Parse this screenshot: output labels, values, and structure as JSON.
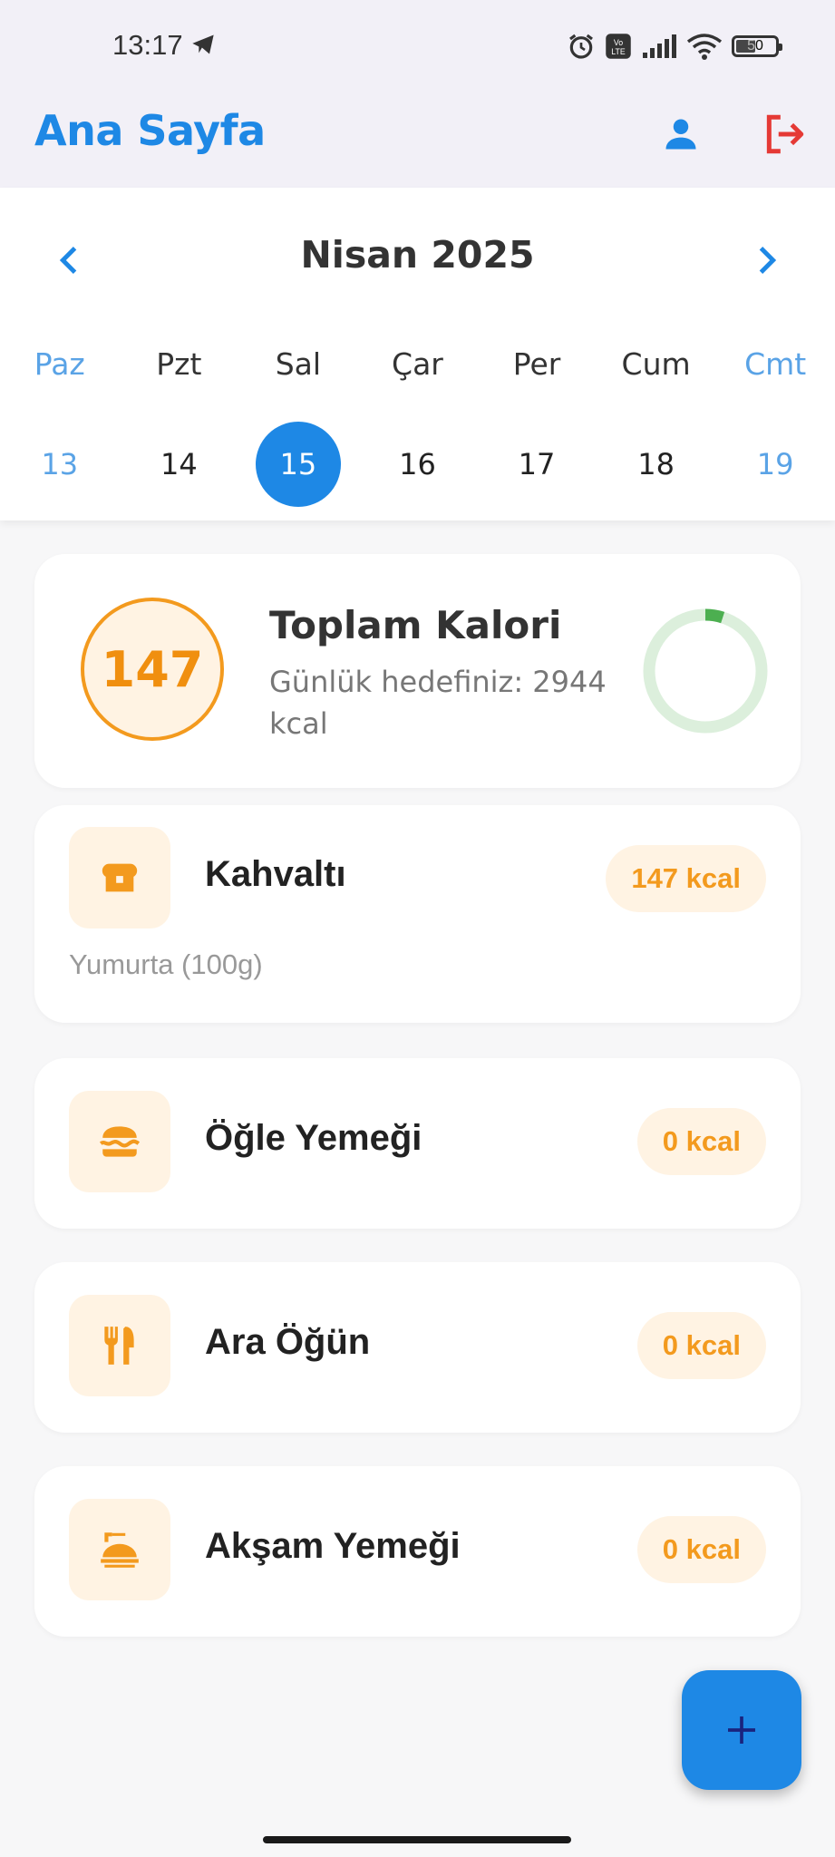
{
  "status_bar": {
    "time": "13:17",
    "battery": "50"
  },
  "app_bar": {
    "title": "Ana Sayfa",
    "profile_icon": "person-icon",
    "logout_icon": "logout-icon"
  },
  "calendar": {
    "month_label": "Nisan 2025",
    "weekdays": [
      "Paz",
      "Pzt",
      "Sal",
      "Çar",
      "Per",
      "Cum",
      "Cmt"
    ],
    "days": [
      "13",
      "14",
      "15",
      "16",
      "17",
      "18",
      "19"
    ],
    "selected_day": "15"
  },
  "summary": {
    "consumed": "147",
    "title": "Toplam Kalori",
    "goal_text": "Günlük hedefiniz: 2944 kcal",
    "progress_fraction": 0.05
  },
  "meals": [
    {
      "title": "Kahvaltı",
      "kcal": "147 kcal",
      "items": "Yumurta (100g)",
      "icon": "breakfast-icon"
    },
    {
      "title": "Öğle Yemeği",
      "kcal": "0 kcal",
      "icon": "burger-icon"
    },
    {
      "title": "Ara Öğün",
      "kcal": "0 kcal",
      "icon": "cutlery-icon"
    },
    {
      "title": "Akşam Yemeği",
      "kcal": "0 kcal",
      "icon": "dinner-icon"
    }
  ],
  "colors": {
    "primary": "#1e88e5",
    "accent_orange": "#f39a1e",
    "logout_red": "#e53935",
    "progress_green": "#4caf50"
  }
}
